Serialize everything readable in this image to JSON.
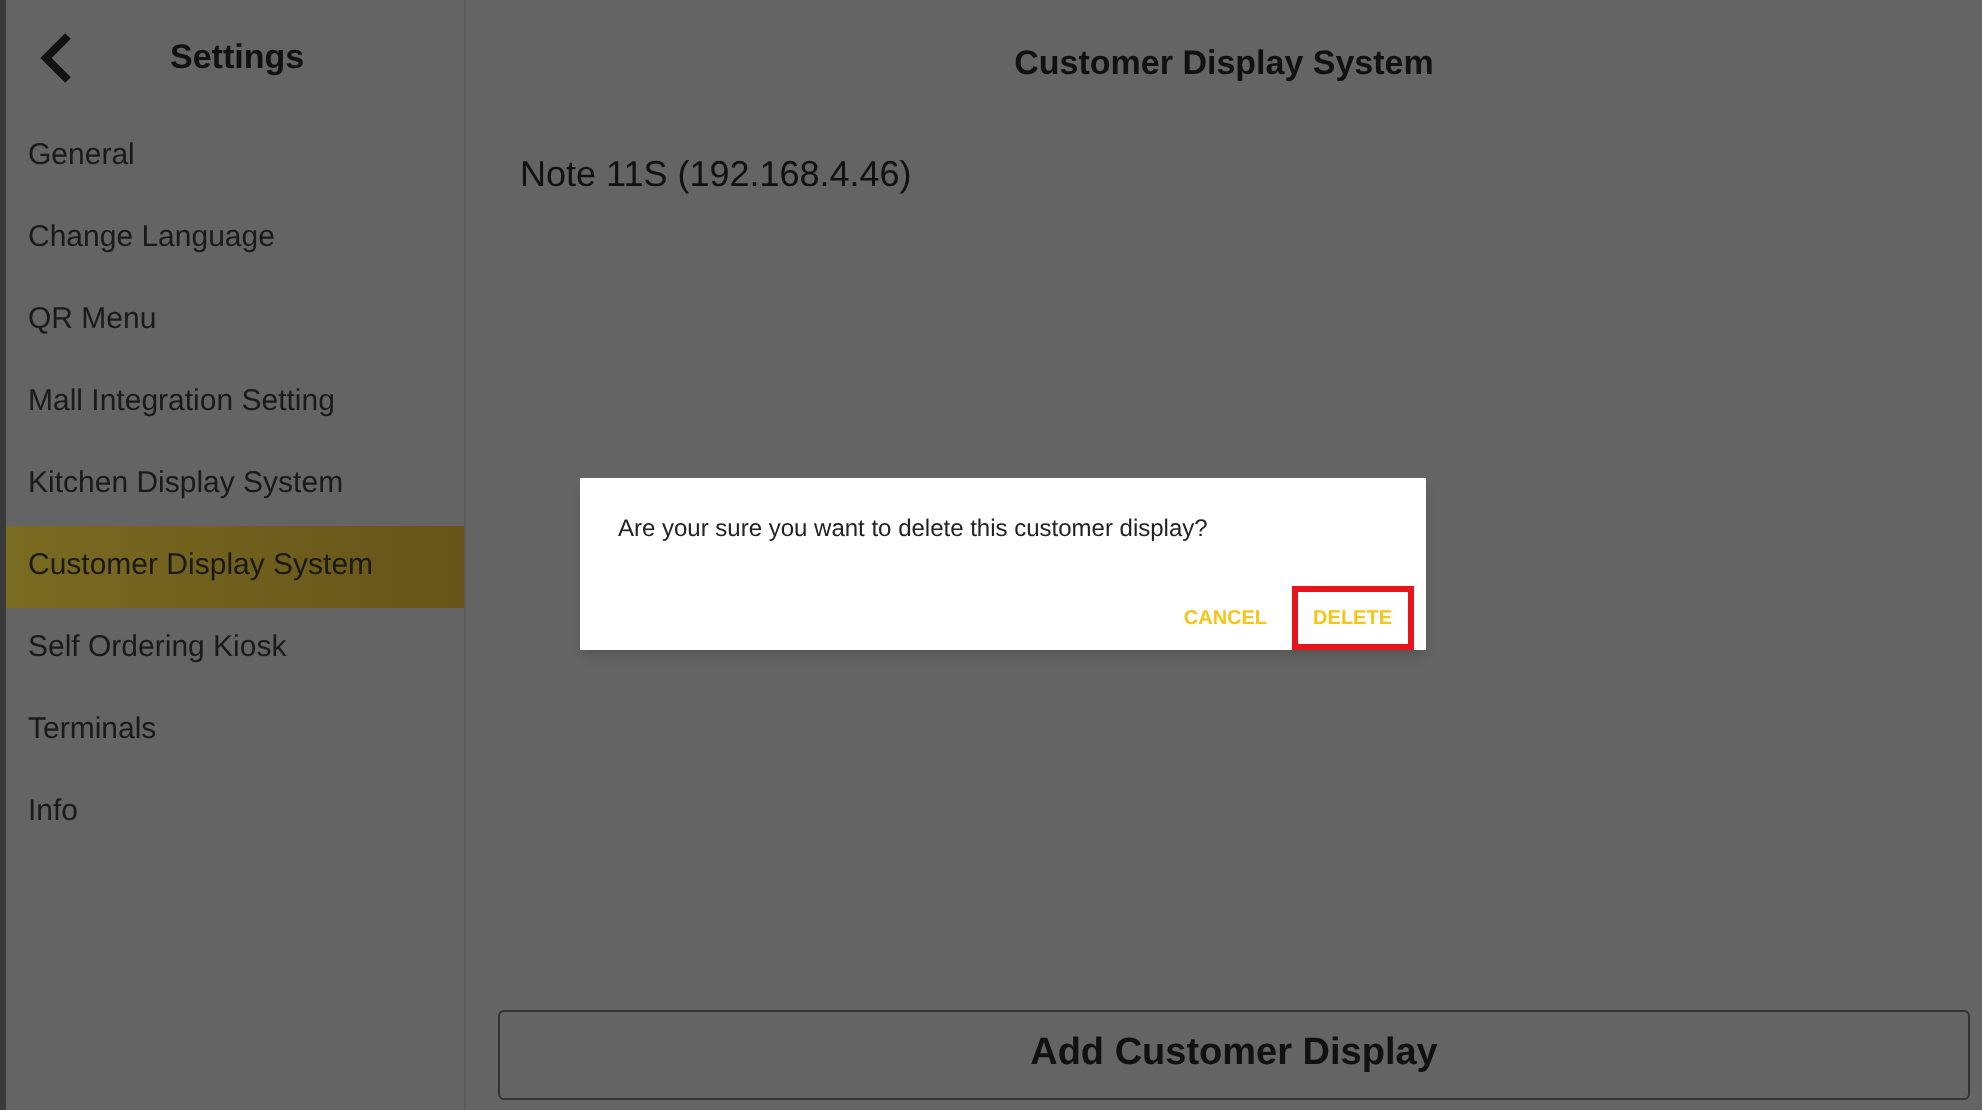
{
  "sidebar": {
    "title": "Settings",
    "items": [
      {
        "label": "General",
        "selected": false
      },
      {
        "label": "Change Language",
        "selected": false
      },
      {
        "label": "QR Menu",
        "selected": false
      },
      {
        "label": "Mall Integration Setting",
        "selected": false
      },
      {
        "label": "Kitchen Display System",
        "selected": false
      },
      {
        "label": "Customer Display System",
        "selected": true
      },
      {
        "label": "Self Ordering Kiosk",
        "selected": false
      },
      {
        "label": "Terminals",
        "selected": false
      },
      {
        "label": "Info",
        "selected": false
      }
    ]
  },
  "main": {
    "title": "Customer Display System",
    "devices": [
      "Note 11S (192.168.4.46)"
    ],
    "add_button": "Add Customer Display"
  },
  "dialog": {
    "message": "Are your sure you want to delete this customer display?",
    "buttons": [
      {
        "label": "CANCEL",
        "highlighted": false
      },
      {
        "label": "DELETE",
        "highlighted": true
      }
    ]
  }
}
